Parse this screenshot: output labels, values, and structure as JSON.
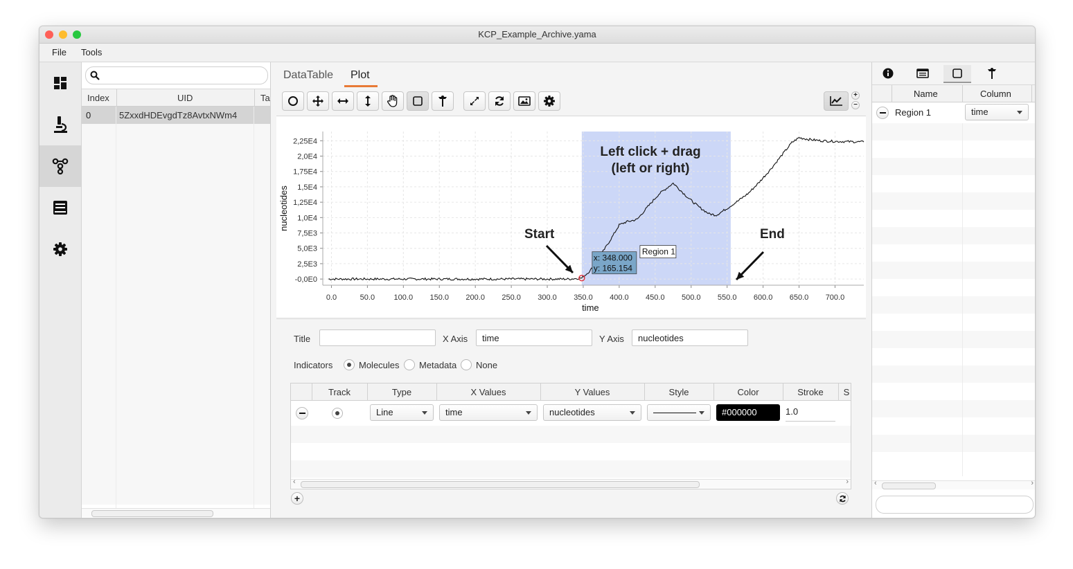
{
  "window": {
    "title": "KCP_Example_Archive.yama",
    "traffic_colors": [
      "#fe5f57",
      "#febc2e",
      "#28c840"
    ]
  },
  "menu": {
    "items": [
      "File",
      "Tools"
    ]
  },
  "sidebar": {
    "icons": [
      "dashboard-icon",
      "microscope-icon",
      "molecule-icon",
      "book-icon",
      "gear-icon"
    ],
    "active_index": 2
  },
  "archive_list": {
    "search": {
      "value": "",
      "placeholder": ""
    },
    "columns": [
      "Index",
      "UID",
      "Ta"
    ],
    "rows": [
      {
        "index": "0",
        "uid": "5ZxxdHDEvgdTz8AvtxNWm4"
      }
    ]
  },
  "center": {
    "tabs": [
      "DataTable",
      "Plot"
    ],
    "active_tab": "Plot",
    "toolbar_icons": [
      "circle-tool-icon",
      "move-tool-icon",
      "horizontal-scale-icon",
      "vertical-scale-icon",
      "hand-icon",
      "region-select-icon",
      "position-marker-icon",
      "fit-to-view-icon",
      "refresh-icon",
      "image-export-icon",
      "settings-icon"
    ],
    "toolbar_active": "region-select-icon",
    "plot_type_icon": "line-chart-icon"
  },
  "plot": {
    "annotation_title": "Left click + drag\n(left or right)",
    "start_label": "Start",
    "end_label": "End",
    "region_label": "Region 1",
    "cursor_x": "x: 348.000",
    "cursor_y": "y: 165.154",
    "region_color": "#ccd7f7"
  },
  "chart_data": {
    "type": "line",
    "xlabel": "time",
    "ylabel": "nucleotides",
    "xlim": [
      -12,
      740
    ],
    "ylim": [
      -1000,
      24000
    ],
    "x_ticks": [
      "0.0",
      "50.0",
      "100.0",
      "150.0",
      "200.0",
      "250.0",
      "300.0",
      "350.0",
      "400.0",
      "450.0",
      "500.0",
      "550.0",
      "600.0",
      "650.0",
      "700.0"
    ],
    "y_ticks": [
      "-0,0E0",
      "2,5E3",
      "5,0E3",
      "7,5E3",
      "1,0E4",
      "1,25E4",
      "1,5E4",
      "1,75E4",
      "2,0E4",
      "2,25E4"
    ],
    "region": [
      348,
      555
    ],
    "series": [
      {
        "x": [
          -4,
          0,
          50,
          100,
          150,
          200,
          250,
          300,
          330,
          348,
          360,
          375,
          390,
          400,
          410,
          425,
          440,
          455,
          475,
          495,
          510,
          525,
          535,
          550,
          565,
          580,
          595,
          610,
          625,
          640,
          650,
          665,
          680,
          700,
          720,
          740
        ],
        "y": [
          0,
          0,
          0,
          0,
          0,
          0,
          0,
          0,
          0,
          165,
          1400,
          4000,
          6800,
          8800,
          9300,
          9700,
          11800,
          13800,
          15600,
          13300,
          11800,
          10600,
          10400,
          11500,
          12700,
          14000,
          15800,
          17800,
          20000,
          22200,
          23000,
          22700,
          22500,
          22400,
          22350,
          22300
        ]
      }
    ]
  },
  "plot_properties": {
    "title_label": "Title",
    "title_value": "",
    "xaxis_label": "X Axis",
    "xaxis_value": "time",
    "yaxis_label": "Y Axis",
    "yaxis_value": "nucleotides",
    "indicators_label": "Indicators",
    "indicators": [
      "Molecules",
      "Metadata",
      "None"
    ],
    "indicators_selected": "Molecules",
    "columns": [
      "Track",
      "Type",
      "X Values",
      "Y Values",
      "Style",
      "Color",
      "Stroke",
      "S"
    ],
    "rows": [
      {
        "type": "Line",
        "x_values": "time",
        "y_values": "nucleotides",
        "color": "#000000",
        "stroke": "1.0"
      }
    ]
  },
  "regions_panel": {
    "tab_icons": [
      "info-icon",
      "list-icon",
      "region-icon",
      "position-icon"
    ],
    "columns": [
      "Name",
      "Column"
    ],
    "rows": [
      {
        "name": "Region 1",
        "column": "time"
      }
    ],
    "filter": {
      "value": "",
      "placeholder": ""
    }
  }
}
